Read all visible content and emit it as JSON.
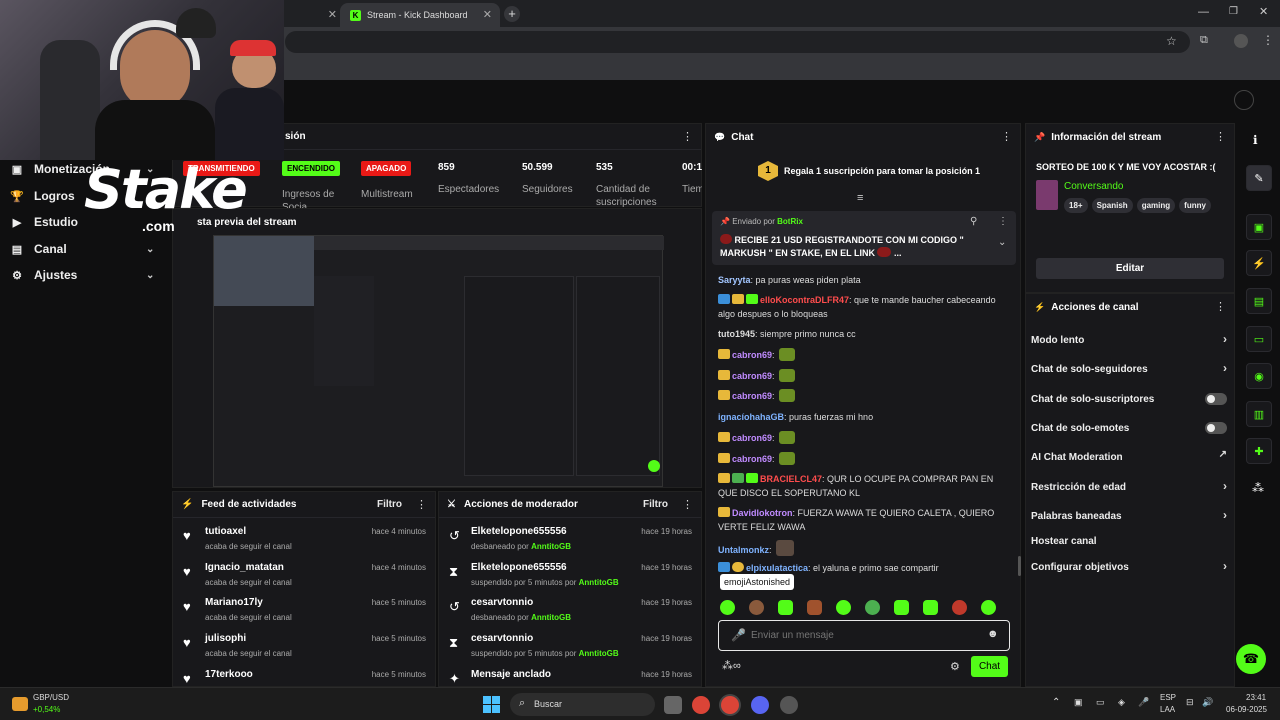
{
  "browser": {
    "tab_title": "Stream - Kick Dashboard"
  },
  "sidebar": {
    "items": [
      {
        "label": "Monetización",
        "icon": "dollar-icon"
      },
      {
        "label": "Logros",
        "icon": "trophy-icon"
      },
      {
        "label": "Estudio",
        "icon": "camera-icon"
      },
      {
        "label": "Canal",
        "icon": "channel-icon"
      },
      {
        "label": "Ajustes",
        "icon": "gear-icon"
      }
    ]
  },
  "overlay": {
    "logo_text": "Stake",
    "logo_sub": ".com"
  },
  "session": {
    "title_fragment": "sión",
    "badges": {
      "live": "TRANSMITIENDO",
      "encoder": "ENCENDIDO",
      "multistream": "APAGADO"
    },
    "labels": {
      "encoder": "Ingresos de Socia",
      "multistream": "Multistream"
    },
    "stats": [
      {
        "value": "859",
        "label": "Espectadores"
      },
      {
        "value": "50.599",
        "label": "Seguidores"
      },
      {
        "value": "535",
        "label": "Cantidad de suscripciones"
      },
      {
        "value": "00:1",
        "label": "Tiem"
      }
    ]
  },
  "preview": {
    "title": "sta previa del stream"
  },
  "activity": {
    "title": "Feed de actividades",
    "filter": "Filtro",
    "rows": [
      {
        "name": "tutioaxel",
        "sub": "acaba de seguir el canal",
        "time": "hace 4 minutos"
      },
      {
        "name": "Ignacio_matatan",
        "sub": "acaba de seguir el canal",
        "time": "hace 4 minutos"
      },
      {
        "name": "Mariano17ly",
        "sub": "acaba de seguir el canal",
        "time": "hace 5 minutos"
      },
      {
        "name": "julisophi",
        "sub": "acaba de seguir el canal",
        "time": "hace 5 minutos"
      },
      {
        "name": "17terkooo",
        "sub": "",
        "time": "hace 5 minutos"
      }
    ]
  },
  "modactions": {
    "title": "Acciones de moderador",
    "filter": "Filtro",
    "rows": [
      {
        "name": "Elketelopone655556",
        "sub": "desbaneado por",
        "by": "AnntitoGB",
        "time": "hace 19 horas"
      },
      {
        "name": "Elketelopone655556",
        "sub": "suspendido por 5 minutos por",
        "by": "AnntitoGB",
        "time": "hace 19 horas"
      },
      {
        "name": "cesarvtonnio",
        "sub": "desbaneado por",
        "by": "AnntitoGB",
        "time": "hace 19 horas"
      },
      {
        "name": "cesarvtonnio",
        "sub": "suspendido por 5 minutos por",
        "by": "AnntitoGB",
        "time": "hace 19 horas"
      },
      {
        "name": "Mensaje anclado",
        "sub": "",
        "by": "",
        "time": "hace 19 horas"
      }
    ]
  },
  "chat": {
    "title": "Chat",
    "goal": {
      "rank": "1",
      "text": "Regala 1 suscripción para tomar la posición 1"
    },
    "pinned": {
      "prefix": "Enviado por",
      "user": "BotRix",
      "text": "RECIBE 21 USD REGISTRANDOTE CON MI CODIGO \" MARKUSH \" EN STAKE, EN EL LINK",
      "tail": "..."
    },
    "messages": [
      {
        "user": "Saryyta",
        "color": "#a3c6ff",
        "text": "pa puras weas piden plata"
      },
      {
        "user": "elloKocontraDLFR47",
        "color": "#ff4d4d",
        "text": "que te mande baucher cabeceando algo despues o lo bloqueas"
      },
      {
        "user": "tuto1945",
        "color": "#dddddd",
        "text": "siempre primo nunca cc"
      },
      {
        "user": "cabron69",
        "color": "#c08bff",
        "text": ""
      },
      {
        "user": "cabron69",
        "color": "#c08bff",
        "text": ""
      },
      {
        "user": "cabron69",
        "color": "#c08bff",
        "text": ""
      },
      {
        "user": "ignacíohahaGB",
        "color": "#7fb3ff",
        "text": "puras fuerzas mi hno"
      },
      {
        "user": "cabron69",
        "color": "#c08bff",
        "text": ""
      },
      {
        "user": "cabron69",
        "color": "#c08bff",
        "text": ""
      },
      {
        "user": "BRACIELCL47",
        "color": "#ff4d4d",
        "text": "QUR LO OCUPE PA COMPRAR PAN EN QUE DISCO EL SOPERUTANO KL"
      },
      {
        "user": "Davidlokotron",
        "color": "#c08bff",
        "text": "FUERZA WAWA TE QUIERO CALETA , QUIERO VERTE FELIZ WAWA"
      },
      {
        "user": "Untalmonkz",
        "color": "#7fb3ff",
        "text": ""
      },
      {
        "user": "elpixulatactica",
        "color": "#7fb3ff",
        "text": "el yaluna e primo sae compartir"
      }
    ],
    "tooltip": "emojiAstonished",
    "placeholder": "Enviar un mensaje",
    "send": "Chat"
  },
  "info": {
    "title": "Información del stream",
    "stream_title": "SORTEO DE 100 K Y ME VOY ACOSTAR :(",
    "category": "Conversando",
    "tags": [
      "18+",
      "Spanish",
      "gaming",
      "funny"
    ],
    "edit": "Editar"
  },
  "channel_actions": {
    "title": "Acciones de canal",
    "rows": [
      {
        "label": "Modo lento",
        "kind": "chevron"
      },
      {
        "label": "Chat de solo-seguidores",
        "kind": "chevron"
      },
      {
        "label": "Chat de solo-suscriptores",
        "kind": "toggle"
      },
      {
        "label": "Chat de solo-emotes",
        "kind": "toggle"
      },
      {
        "label": "AI Chat Moderation",
        "kind": "external"
      },
      {
        "label": "Restricción de edad",
        "kind": "chevron"
      },
      {
        "label": "Palabras baneadas",
        "kind": "chevron"
      },
      {
        "label": "Hostear canal",
        "kind": "none"
      },
      {
        "label": "Configurar objetivos",
        "kind": "chevron"
      }
    ]
  },
  "taskbar": {
    "ticker": "GBP/USD",
    "ticker_change": "+0,54%",
    "search": "Buscar",
    "lang": "ESP",
    "lang_sub": "LAA",
    "time": "23:41",
    "date": "06-09-2025"
  },
  "colors": {
    "accent": "#53fc18",
    "live": "#e91916",
    "panel": "#18181b"
  }
}
